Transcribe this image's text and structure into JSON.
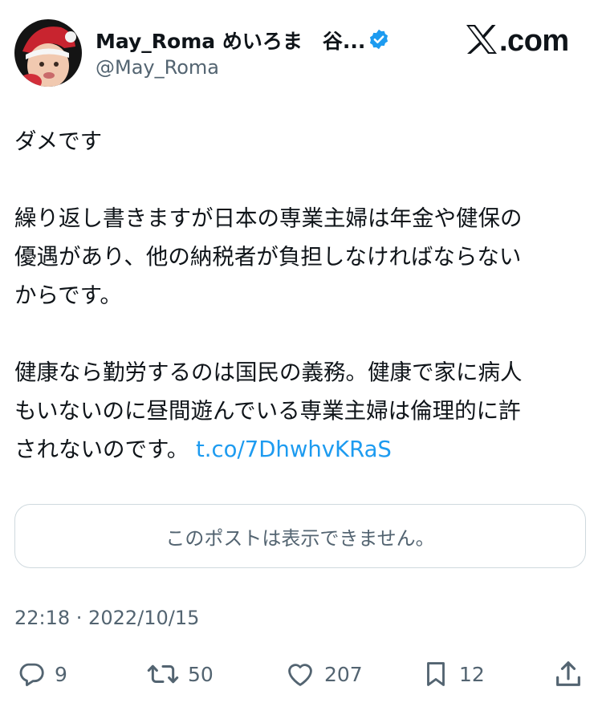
{
  "header": {
    "display_name": "May_Roma めいろま　谷...",
    "handle": "@May_Roma",
    "brand": ".com"
  },
  "tweet": {
    "lines_block1": [
      "ダメです"
    ],
    "lines_block2": [
      "繰り返し書きますが日本の専業主婦は年金や健保の",
      "優遇があり、他の納税者が負担しなければならない",
      "からです。"
    ],
    "lines_block3": [
      "健康なら勤労するのは国民の義務。健康で家に病人",
      "もいないのに昼間遊んでいる専業主婦は倫理的に許"
    ],
    "last_line_text": "されないのです。",
    "link_text": "t.co/7DhwhvKRaS"
  },
  "quote": {
    "unavailable_text": "このポストは表示できません。"
  },
  "timestamp": "22:18 · 2022/10/15",
  "actions": {
    "reply_count": "9",
    "retweet_count": "50",
    "like_count": "207",
    "bookmark_count": "12"
  },
  "colors": {
    "text": "#0f1419",
    "secondary": "#536471",
    "link": "#1d9bf0",
    "verified": "#1d9bf0",
    "border": "#cfd9de"
  },
  "icons": [
    "verified-badge-icon",
    "x-logo-icon",
    "reply-icon",
    "retweet-icon",
    "like-icon",
    "bookmark-icon",
    "share-icon"
  ]
}
